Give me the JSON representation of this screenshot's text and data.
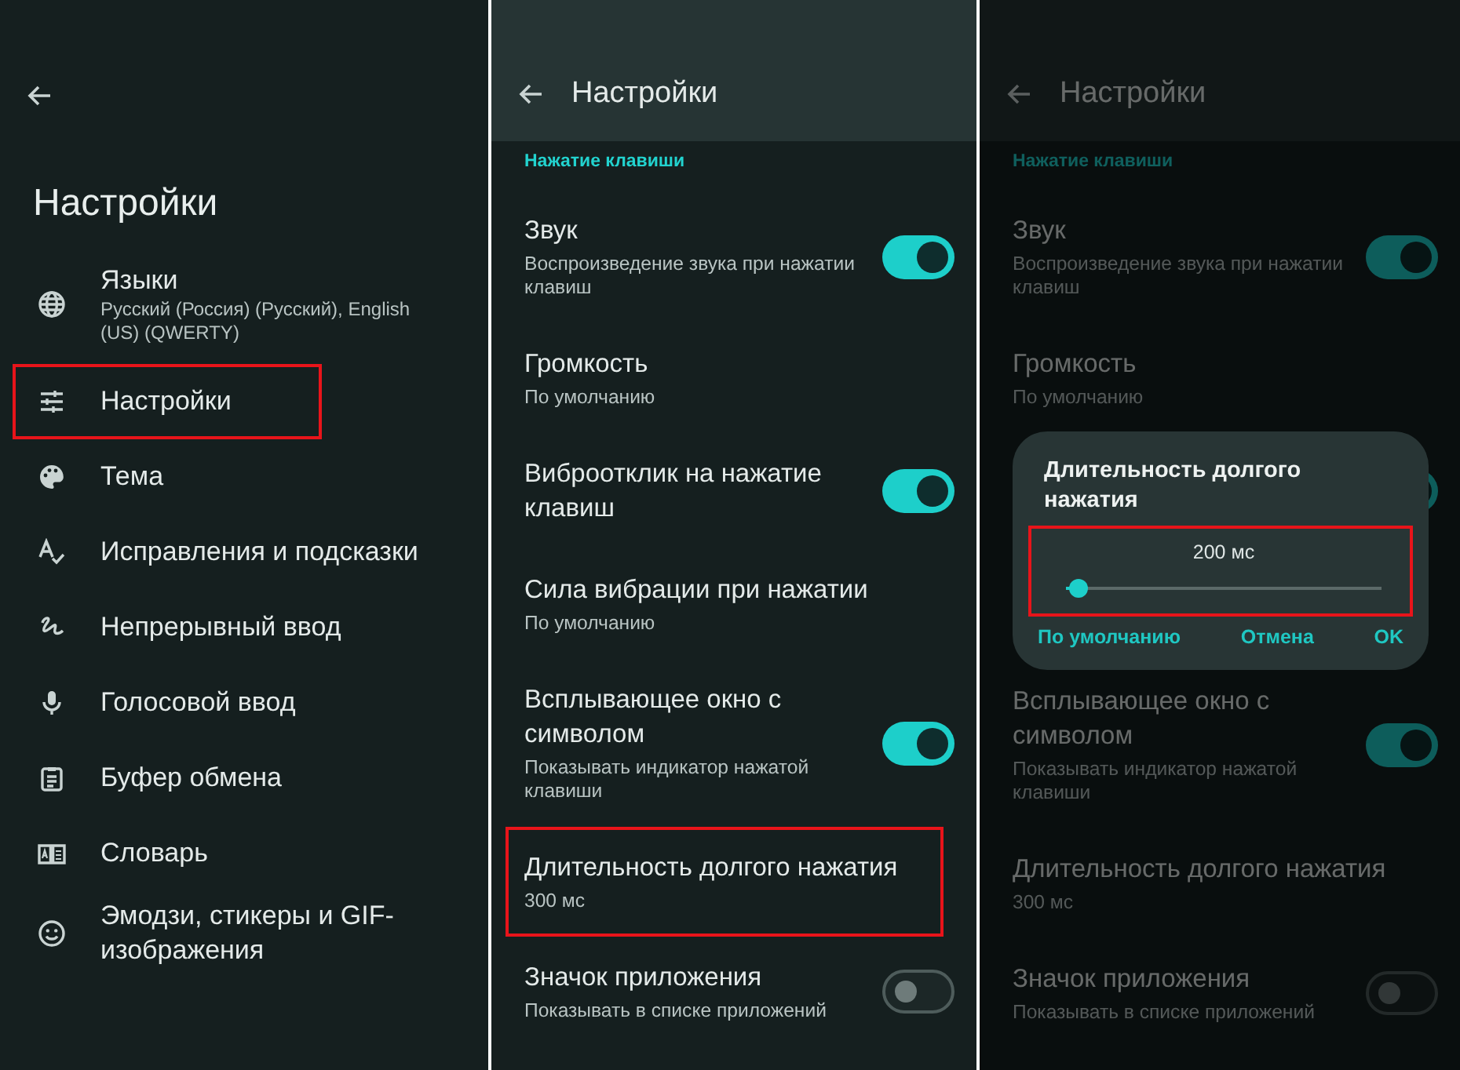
{
  "screens": [
    {
      "kind": "menu",
      "title": "Настройки",
      "items": [
        {
          "label": "Языки",
          "summary": "Русский (Россия) (Русский), English (US) (QWERTY)",
          "highlighted": false
        },
        {
          "label": "Настройки",
          "highlighted": true
        },
        {
          "label": "Тема",
          "highlighted": false
        },
        {
          "label": "Исправления и подсказки",
          "highlighted": false
        },
        {
          "label": "Непрерывный ввод",
          "highlighted": false
        },
        {
          "label": "Голосовой ввод",
          "highlighted": false
        },
        {
          "label": "Буфер обмена",
          "highlighted": false
        },
        {
          "label": "Словарь",
          "highlighted": false
        },
        {
          "label": "Эмодзи, стикеры и GIF-изображения",
          "highlighted": false
        }
      ]
    },
    {
      "kind": "prefs",
      "title": "Настройки",
      "section": "Нажатие клавиши",
      "items": [
        {
          "kind": "switch",
          "title": "Звук",
          "summary": "Воспроизведение звука при нажатии клавиш",
          "on": true,
          "highlighted": false
        },
        {
          "kind": "plain",
          "title": "Громкость",
          "summary": "По умолчанию",
          "highlighted": false
        },
        {
          "kind": "switch",
          "title": "Виброотклик на нажатие клавиш",
          "on": true,
          "highlighted": false
        },
        {
          "kind": "plain",
          "title": "Сила вибрации при нажатии",
          "summary": "По умолчанию",
          "highlighted": false
        },
        {
          "kind": "switch",
          "title": "Всплывающее окно с символом",
          "summary": "Показывать индикатор нажатой клавиши",
          "on": true,
          "highlighted": false
        },
        {
          "kind": "plain",
          "title": "Длительность долгого нажатия",
          "summary": "300 мс",
          "highlighted": true
        },
        {
          "kind": "switch",
          "title": "Значок приложения",
          "summary": "Показывать в списке приложений",
          "on": false,
          "highlighted": false
        }
      ]
    },
    {
      "kind": "prefs",
      "title": "Настройки",
      "section": "Нажатие клавиши",
      "dimmed": true,
      "items": [
        {
          "kind": "switch",
          "title": "Звук",
          "summary": "Воспроизведение звука при нажатии клавиш",
          "on": true
        },
        {
          "kind": "plain",
          "title": "Громкость",
          "summary": "По умолчанию"
        },
        {
          "kind": "switch",
          "on": true
        },
        {
          "kind": "plain"
        },
        {
          "kind": "switch",
          "title": "Всплывающее окно с символом",
          "summary": "Показывать индикатор нажатой клавиши",
          "on": true
        },
        {
          "kind": "plain",
          "title": "Длительность долгого нажатия",
          "summary": "300 мс"
        },
        {
          "kind": "switch",
          "title": "Значок приложения",
          "summary": "Показывать в списке приложений",
          "on": false
        }
      ],
      "dialog": {
        "title": "Длительность долгого нажатия",
        "value": "200 мс",
        "level": 0.04,
        "highlighted": true,
        "buttons": [
          "По умолчанию",
          "Отмена",
          "OK"
        ]
      }
    }
  ]
}
